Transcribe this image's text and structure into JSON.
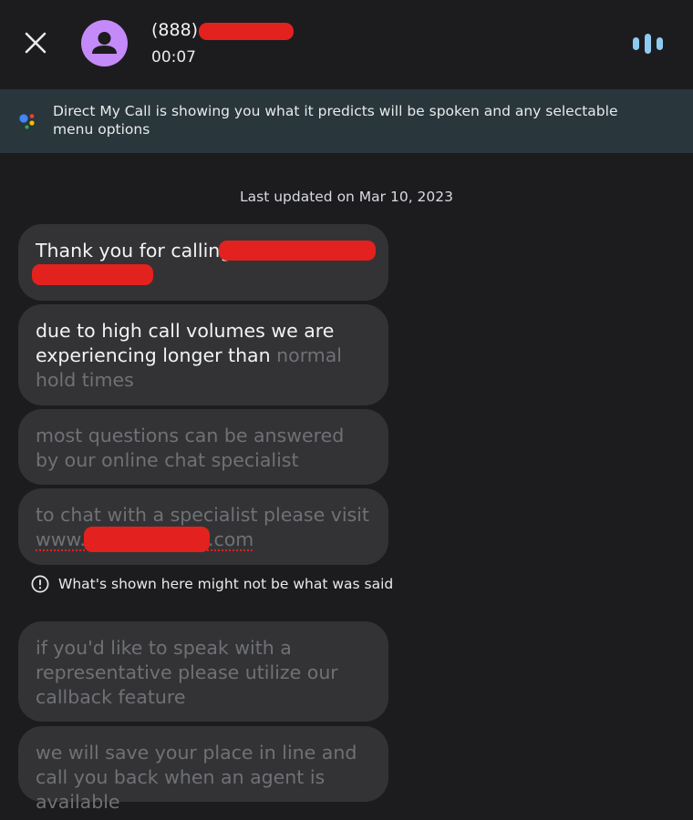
{
  "call": {
    "caller_number_prefix": "(888)",
    "timer": "00:07"
  },
  "icons": {
    "close": "close-icon",
    "avatar": "person-avatar-icon",
    "audio": "audio-bars-icon",
    "assistant": "google-assistant-dots-icon",
    "info": "info-circle-icon"
  },
  "colors": {
    "background": "#1c1c1e",
    "banner": "#29363b",
    "avatar": "#c58af9",
    "audio_bars": "#8ecbf0",
    "bubble": "#333335",
    "redaction": "#e3211f"
  },
  "banner": {
    "text": "Direct My Call is showing you what it predicts will be spoken and any selectable menu options"
  },
  "transcript": {
    "last_updated": "Last updated on Mar 10, 2023",
    "messages": [
      {
        "spoken": "Thank you for calling",
        "predicted": ""
      },
      {
        "spoken": "due to high call volumes we are experiencing longer than",
        "predicted": "normal hold times"
      },
      {
        "spoken": "",
        "predicted": "most questions can be answered by our online chat specialist"
      },
      {
        "spoken": "",
        "predicted_line1": "to chat with a specialist please visit",
        "link_prefix": "www.",
        "link_suffix": ".com"
      },
      {
        "spoken": "",
        "predicted": "if you'd like to speak with a representative please utilize our callback feature"
      },
      {
        "spoken": "",
        "predicted": "we will save your place in line and call you back when an agent is available"
      }
    ],
    "disclaimer": "What's shown here might not be what was said"
  }
}
